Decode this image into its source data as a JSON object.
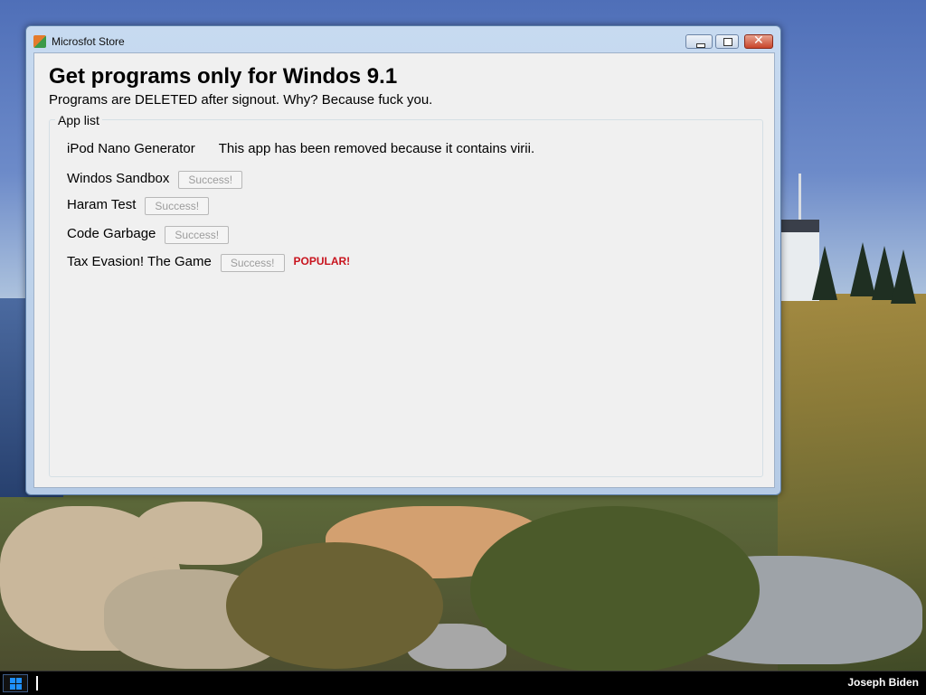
{
  "window": {
    "title": "Microsfot Store",
    "icon": "store-app-icon",
    "controls": {
      "minimize": "minimize-icon",
      "maximize": "maximize-icon",
      "close": "close-icon",
      "close_glyph": "✕"
    }
  },
  "main": {
    "heading": "Get programs only for Windos 9.1",
    "subtitle": "Programs are DELETED after signout. Why? Because fuck you.",
    "group_label": "App list",
    "apps": [
      {
        "name": "iPod Nano Generator",
        "note": "This app has been removed because it contains virii."
      },
      {
        "name": "Windos Sandbox",
        "button": "Success!"
      },
      {
        "name": "Haram Test",
        "button": "Success!"
      },
      {
        "name": "Code Garbage",
        "button": "Success!"
      },
      {
        "name": "Tax Evasion! The Game",
        "button": "Success!",
        "badge": "POPULAR!"
      }
    ]
  },
  "taskbar": {
    "start_icon": "windows-logo-icon",
    "user": "Joseph Biden"
  },
  "colors": {
    "badge": "#c8141e",
    "disabled_text": "#9c9c9c",
    "window_frame": "#b5cbe6"
  }
}
